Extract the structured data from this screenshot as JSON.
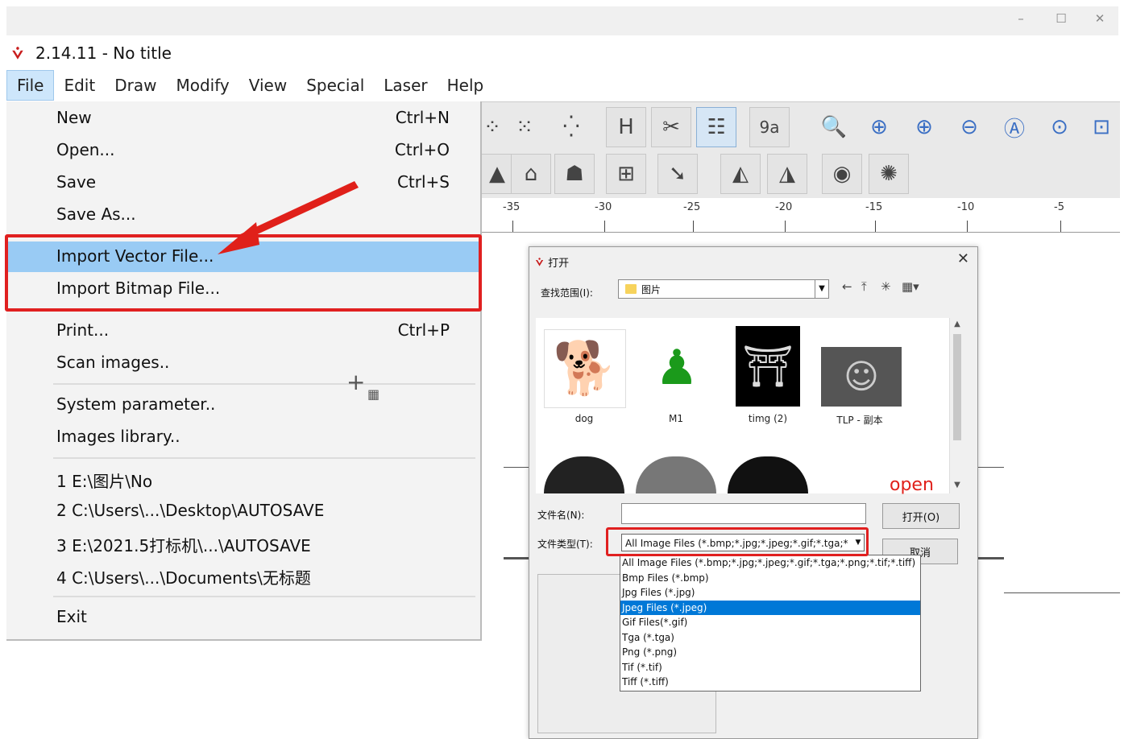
{
  "window": {
    "title": "2.14.11 - No title",
    "controls": [
      "–",
      "☐",
      "✕"
    ]
  },
  "menubar": [
    "File",
    "Edit",
    "Draw",
    "Modify",
    "View",
    "Special",
    "Laser",
    "Help"
  ],
  "file_menu": {
    "new": {
      "label": "New",
      "shortcut": "Ctrl+N"
    },
    "open": {
      "label": "Open...",
      "shortcut": "Ctrl+O"
    },
    "save": {
      "label": "Save",
      "shortcut": "Ctrl+S"
    },
    "save_as": {
      "label": "Save As..."
    },
    "import_vector": {
      "label": "Import Vector File..."
    },
    "import_bitmap": {
      "label": "Import Bitmap File..."
    },
    "print": {
      "label": "Print...",
      "shortcut": "Ctrl+P"
    },
    "scan": {
      "label": "Scan images.."
    },
    "system": {
      "label": "System parameter.."
    },
    "library": {
      "label": "Images library.."
    },
    "recent": [
      "1 E:\\图片\\No",
      "2 C:\\Users\\...\\Desktop\\AUTOSAVE",
      "3 E:\\2021.5打标机\\...\\AUTOSAVE",
      "4 C:\\Users\\...\\Documents\\无标题"
    ],
    "exit": {
      "label": "Exit"
    }
  },
  "ruler": [
    "-35",
    "-30",
    "-25",
    "-20",
    "-15",
    "-10",
    "-5"
  ],
  "toolbar": {
    "row1": [
      "nodes-icon",
      "nodes-icon",
      "nodes-icon",
      "h-align-icon",
      "tools-icon",
      "list-icon",
      "text-icon",
      "zoom-icon",
      "zoom-in-icon",
      "zoom-plus-icon",
      "zoom-minus-icon",
      "zoom-all-icon",
      "zoom-fit-icon",
      "zoom-page-icon"
    ],
    "row2": [
      "lock-icon",
      "lock-icon",
      "lock-icon",
      "pos-icon",
      "cursor-icon",
      "mirror-h-icon",
      "mirror-v-icon",
      "eye-icon",
      "eye-icon"
    ]
  },
  "dialog": {
    "title": "打开",
    "look_in_label": "查找范围(I):",
    "look_in_value": "图片",
    "thumbnails": [
      "dog",
      "M1",
      "timg (2)",
      "TLP - 副本"
    ],
    "filename_label": "文件名(N):",
    "filename_value": "",
    "filetype_label": "文件类型(T):",
    "filetype_value": "All Image Files (*.bmp;*.jpg;*.jpeg;*.gif;*.tga;*",
    "open_button": "打开(O)",
    "cancel_button": "取消",
    "filetype_options": [
      "All Image Files (*.bmp;*.jpg;*.jpeg;*.gif;*.tga;*.png;*.tif;*.tiff)",
      "Bmp Files (*.bmp)",
      "Jpg Files (*.jpg)",
      "Jpeg Files (*.jpeg)",
      "Gif Files(*.gif)",
      "Tga (*.tga)",
      "Png (*.png)",
      "Tif (*.tif)",
      "Tiff (*.tiff)"
    ],
    "selected_option": 3
  },
  "annotation": {
    "open_text": "open",
    "color": "#e0201a"
  }
}
